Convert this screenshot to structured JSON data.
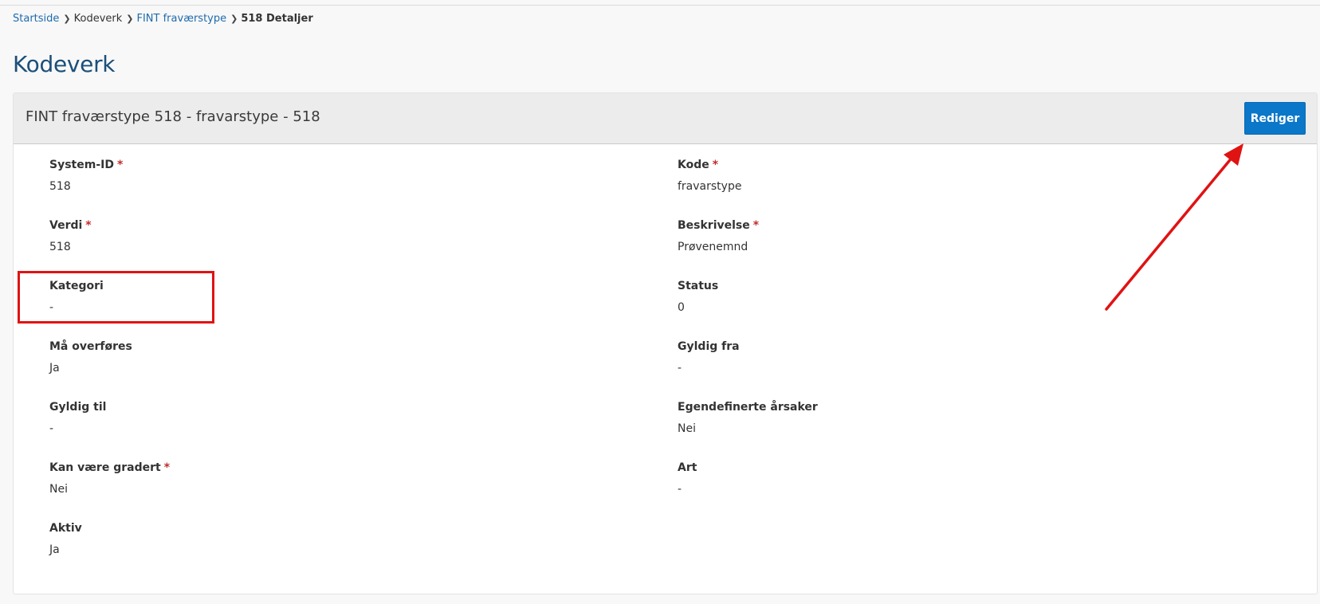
{
  "breadcrumb": {
    "home": "Startside",
    "section": "Kodeverk",
    "type": "FINT fraværstype",
    "current": "518 Detaljer"
  },
  "page": {
    "title": "Kodeverk"
  },
  "card": {
    "title": "FINT fraværstype 518 - fravarstype - 518",
    "edit_label": "Rediger"
  },
  "fields": {
    "system_id": {
      "label": "System-ID",
      "required_mark": "*",
      "value": "518"
    },
    "kode": {
      "label": "Kode",
      "required_mark": "*",
      "value": "fravarstype"
    },
    "verdi": {
      "label": "Verdi",
      "required_mark": "*",
      "value": "518"
    },
    "beskrivelse": {
      "label": "Beskrivelse",
      "required_mark": "*",
      "value": "Prøvenemnd"
    },
    "kategori": {
      "label": "Kategori",
      "value": "-"
    },
    "status": {
      "label": "Status",
      "value": "0"
    },
    "maa_overfores": {
      "label": "Må overføres",
      "value": "Ja"
    },
    "gyldig_fra": {
      "label": "Gyldig fra",
      "value": "-"
    },
    "gyldig_til": {
      "label": "Gyldig til",
      "value": "-"
    },
    "egendefinerte_aarsaker": {
      "label": "Egendefinerte årsaker",
      "value": "Nei"
    },
    "kan_vaere_gradert": {
      "label": "Kan være gradert",
      "required_mark": "*",
      "value": "Nei"
    },
    "art": {
      "label": "Art",
      "value": "-"
    },
    "aktiv": {
      "label": "Aktiv",
      "value": "Ja"
    }
  },
  "annotations": {
    "color": "#e01313"
  }
}
